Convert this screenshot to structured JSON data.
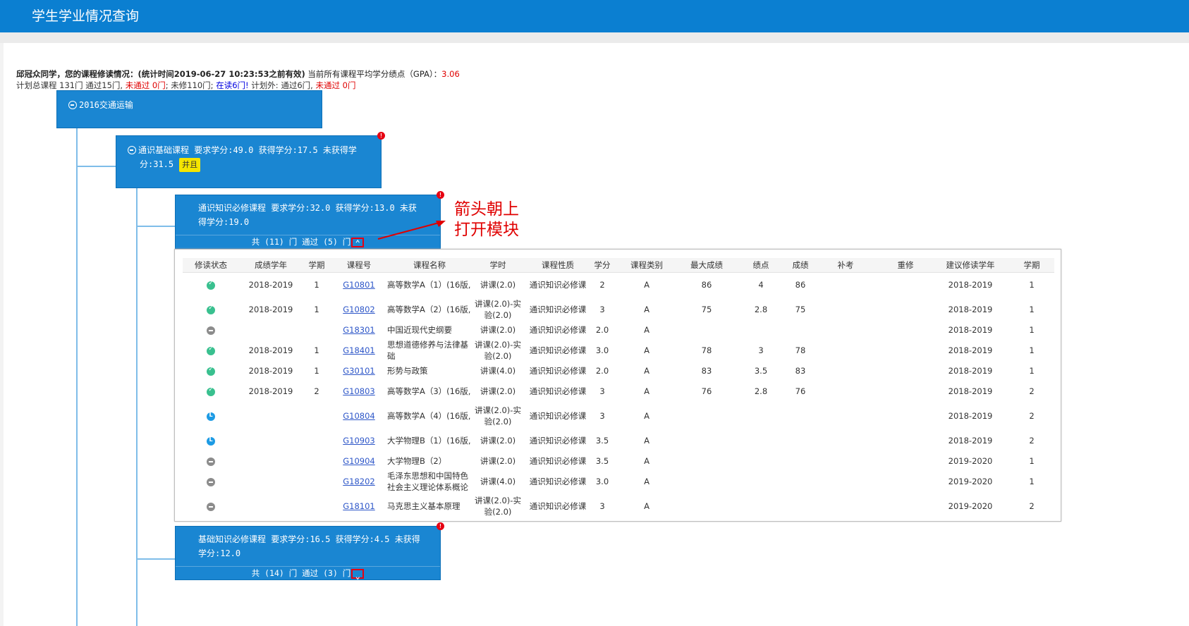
{
  "header": {
    "title": "学生学业情况查询"
  },
  "summary": {
    "line1_bold": "邱冠众同学，您的课程修读情况：(统计时间2019-06-27 10:23:53之前有效)",
    "line1_gpa_label": " 当前所有课程平均学分绩点（GPA）：",
    "line1_gpa_value": "3.06",
    "line2_a": "计划总课程 131门 通过15门, ",
    "line2_fail": "未通过 0门",
    "line2_b": "; 未修110门; ",
    "line2_reading": "在读6门!",
    "line2_c": " 计划外:  通过6门, ",
    "line2_fail2": "未通过 0门"
  },
  "nodes": {
    "root": {
      "label": "2016交通运输"
    },
    "general": {
      "line1": "通识基础课程  要求学分:49.0  获得学分:17.5   未获得学",
      "line2": "分:31.5",
      "badge": "并且"
    },
    "general_required": {
      "line1": "通识知识必修课程  要求学分:32.0  获得学分:13.0   未获",
      "line2": "得学分:19.0",
      "footer": "共 (11) 门 通过 (5) 门"
    },
    "basic_required": {
      "line1": "基础知识必修课程  要求学分:16.5  获得学分:4.5   未获得",
      "line2": "学分:12.0",
      "footer": "共 (14) 门 通过 (3) 门"
    },
    "alert_mark": "!"
  },
  "annotation": {
    "line1": "箭头朝上",
    "line2": "打开模块"
  },
  "table": {
    "headers": [
      "修读状态",
      "成绩学年",
      "学期",
      "课程号",
      "课程名称",
      "学时",
      "课程性质",
      "学分",
      "课程类别",
      "最大成绩",
      "绩点",
      "成绩",
      "补考",
      "重修",
      "建议修读学年",
      "学期"
    ],
    "rows": [
      {
        "status": "passed",
        "year": "2018-2019",
        "term": "1",
        "code": "G10801",
        "name": "高等数学A（1）(16版,",
        "hours": "讲课(2.0)",
        "nature": "通识知识必修课",
        "credit": "2",
        "category": "A",
        "max": "86",
        "gp": "4",
        "score": "86",
        "makeup": "",
        "retake": "",
        "sugyear": "2018-2019",
        "sugterm": "1"
      },
      {
        "status": "passed",
        "year": "2018-2019",
        "term": "1",
        "code": "G10802",
        "name": "高等数学A（2）(16版,",
        "hours": "讲课(2.0)-实验(2.0)",
        "nature": "通识知识必修课",
        "credit": "3",
        "category": "A",
        "max": "75",
        "gp": "2.8",
        "score": "75",
        "makeup": "",
        "retake": "",
        "sugyear": "2018-2019",
        "sugterm": "1"
      },
      {
        "status": "not_taken",
        "year": "",
        "term": "",
        "code": "G18301",
        "name": "中国近现代史纲要",
        "hours": "讲课(2.0)",
        "nature": "通识知识必修课",
        "credit": "2.0",
        "category": "A",
        "max": "",
        "gp": "",
        "score": "",
        "makeup": "",
        "retake": "",
        "sugyear": "2018-2019",
        "sugterm": "1"
      },
      {
        "status": "passed",
        "year": "2018-2019",
        "term": "1",
        "code": "G18401",
        "name": "思想道德修养与法律基础",
        "hours": "讲课(2.0)-实验(2.0)",
        "nature": "通识知识必修课",
        "credit": "3.0",
        "category": "A",
        "max": "78",
        "gp": "3",
        "score": "78",
        "makeup": "",
        "retake": "",
        "sugyear": "2018-2019",
        "sugterm": "1"
      },
      {
        "status": "passed",
        "year": "2018-2019",
        "term": "1",
        "code": "G30101",
        "name": "形势与政策",
        "hours": "讲课(4.0)",
        "nature": "通识知识必修课",
        "credit": "2.0",
        "category": "A",
        "max": "83",
        "gp": "3.5",
        "score": "83",
        "makeup": "",
        "retake": "",
        "sugyear": "2018-2019",
        "sugterm": "1"
      },
      {
        "status": "passed",
        "year": "2018-2019",
        "term": "2",
        "code": "G10803",
        "name": "高等数学A（3）(16版,",
        "hours": "讲课(2.0)",
        "nature": "通识知识必修课",
        "credit": "3",
        "category": "A",
        "max": "76",
        "gp": "2.8",
        "score": "76",
        "makeup": "",
        "retake": "",
        "sugyear": "2018-2019",
        "sugterm": "2"
      },
      {
        "status": "in_progress",
        "year": "",
        "term": "",
        "code": "G10804",
        "name": "高等数学A（4）(16版,",
        "hours": "讲课(2.0)-实验(2.0)",
        "nature": "通识知识必修课",
        "credit": "3",
        "category": "A",
        "max": "",
        "gp": "",
        "score": "",
        "makeup": "",
        "retake": "",
        "sugyear": "2018-2019",
        "sugterm": "2"
      },
      {
        "status": "in_progress",
        "year": "",
        "term": "",
        "code": "G10903",
        "name": "大学物理B（1）(16版,",
        "hours": "讲课(2.0)",
        "nature": "通识知识必修课",
        "credit": "3.5",
        "category": "A",
        "max": "",
        "gp": "",
        "score": "",
        "makeup": "",
        "retake": "",
        "sugyear": "2018-2019",
        "sugterm": "2"
      },
      {
        "status": "not_taken",
        "year": "",
        "term": "",
        "code": "G10904",
        "name": "大学物理B（2）",
        "hours": "讲课(2.0)",
        "nature": "通识知识必修课",
        "credit": "3.5",
        "category": "A",
        "max": "",
        "gp": "",
        "score": "",
        "makeup": "",
        "retake": "",
        "sugyear": "2019-2020",
        "sugterm": "1"
      },
      {
        "status": "not_taken",
        "year": "",
        "term": "",
        "code": "G18202",
        "name": "毛泽东思想和中国特色社会主义理论体系概论",
        "hours": "讲课(4.0)",
        "nature": "通识知识必修课",
        "credit": "3.0",
        "category": "A",
        "max": "",
        "gp": "",
        "score": "",
        "makeup": "",
        "retake": "",
        "sugyear": "2019-2020",
        "sugterm": "1"
      },
      {
        "status": "not_taken",
        "year": "",
        "term": "",
        "code": "G18101",
        "name": "马克思主义基本原理",
        "hours": "讲课(2.0)-实验(2.0)",
        "nature": "通识知识必修课",
        "credit": "3",
        "category": "A",
        "max": "",
        "gp": "",
        "score": "",
        "makeup": "",
        "retake": "",
        "sugyear": "2019-2020",
        "sugterm": "2"
      }
    ]
  },
  "colors": {
    "primary": "#0b7fd1",
    "node_blue": "#1a86d2",
    "alert_red": "#e60012",
    "badge_yellow": "#f5e500",
    "passed_green": "#39c08f"
  },
  "icons": {
    "collapse": "minus-circle-icon",
    "passed": "check-circle-icon",
    "not_taken": "minus-circle-icon",
    "in_progress": "clock-icon",
    "expand_up": "chevron-up-icon",
    "expand_down": "chevron-down-icon"
  }
}
